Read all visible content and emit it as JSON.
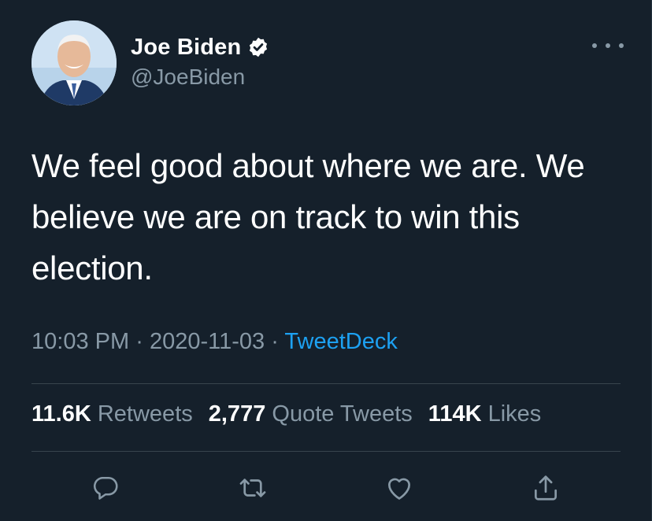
{
  "author": {
    "display_name": "Joe Biden",
    "handle": "@JoeBiden",
    "verified": true
  },
  "tweet": {
    "text": "We feel good about where we are. We believe we are on track to win this election.",
    "time": "10:03 PM",
    "separator": "·",
    "date": "2020-11-03",
    "source": "TweetDeck"
  },
  "stats": {
    "retweets": {
      "count": "11.6K",
      "label": "Retweets"
    },
    "quote_tweets": {
      "count": "2,777",
      "label": "Quote Tweets"
    },
    "likes": {
      "count": "114K",
      "label": "Likes"
    }
  },
  "icons": {
    "verified": "verified-badge-icon",
    "more": "more-options-icon",
    "reply": "reply-icon",
    "retweet": "retweet-icon",
    "like": "like-icon",
    "share": "share-icon"
  },
  "colors": {
    "background": "#15202b",
    "text_primary": "#ffffff",
    "text_secondary": "#8899a6",
    "accent": "#1da1f2",
    "divider": "#38444d"
  }
}
